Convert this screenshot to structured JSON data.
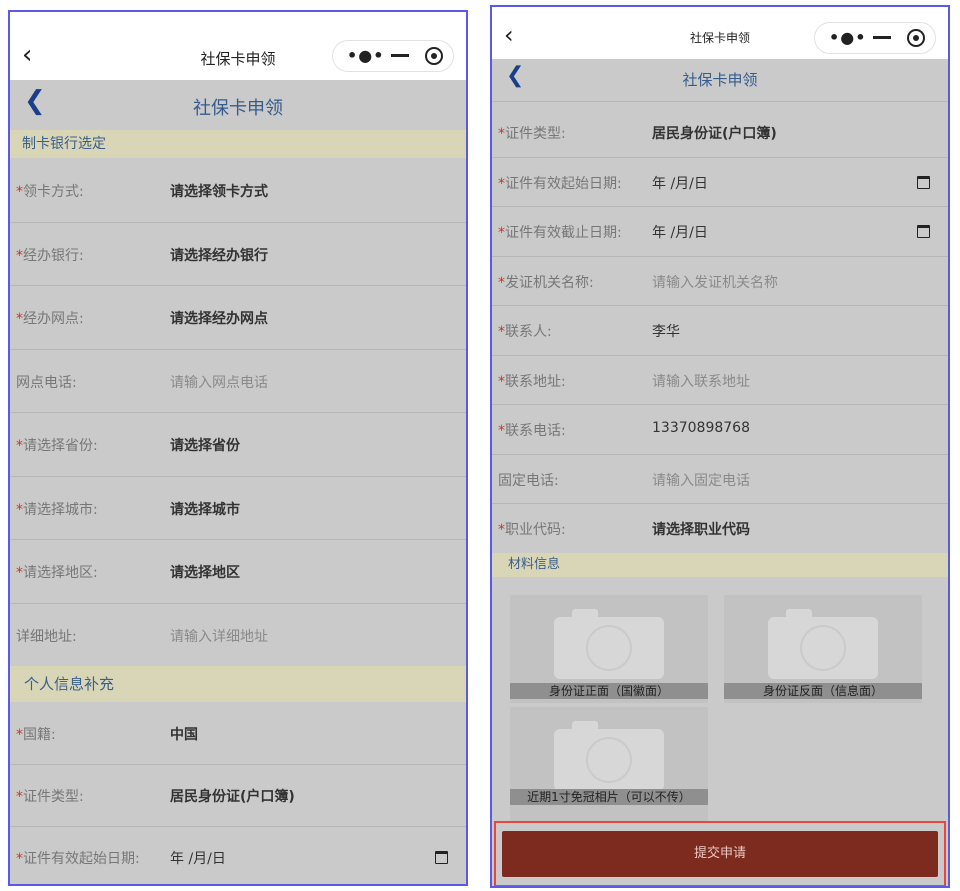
{
  "left": {
    "topbar": {
      "back_icon": "chevron-left-icon",
      "title": "社保卡申领",
      "dots": "•●•"
    },
    "navbar": {
      "back_icon": "chevron-left-icon",
      "title": "社保卡申领"
    },
    "section1": "制卡银行选定",
    "rows1": [
      {
        "req": "*",
        "label": "领卡方式:",
        "value": "请选择领卡方式",
        "kind": "select"
      },
      {
        "req": "*",
        "label": "经办银行:",
        "value": "请选择经办银行",
        "kind": "select"
      },
      {
        "req": "*",
        "label": "经办网点:",
        "value": "请选择经办网点",
        "kind": "select"
      },
      {
        "req": "",
        "label": "网点电话:",
        "value": "请输入网点电话",
        "kind": "input"
      },
      {
        "req": "*",
        "label": "请选择省份:",
        "value": "请选择省份",
        "kind": "select"
      },
      {
        "req": "*",
        "label": "请选择城市:",
        "value": "请选择城市",
        "kind": "select"
      },
      {
        "req": "*",
        "label": "请选择地区:",
        "value": "请选择地区",
        "kind": "select"
      },
      {
        "req": "",
        "label": "详细地址:",
        "value": "请输入详细地址",
        "kind": "input"
      }
    ],
    "section2": "个人信息补充",
    "rows2": [
      {
        "req": "*",
        "label": "国籍:",
        "value": "中国",
        "kind": "select"
      },
      {
        "req": "*",
        "label": "证件类型:",
        "value": "居民身份证(户口簿)",
        "kind": "select"
      },
      {
        "req": "*",
        "label": "证件有效起始日期:",
        "value": "年 /月/日",
        "kind": "date"
      }
    ]
  },
  "right": {
    "topbar": {
      "back_icon": "chevron-left-icon",
      "title": "社保卡申领",
      "dots": "•●•"
    },
    "navbar": {
      "back_icon": "chevron-left-icon",
      "title": "社保卡申领"
    },
    "rows": [
      {
        "req": "*",
        "label": "证件类型:",
        "value": "居民身份证(户口簿)",
        "kind": "select"
      },
      {
        "req": "*",
        "label": "证件有效起始日期:",
        "value": "年 /月/日",
        "kind": "date"
      },
      {
        "req": "*",
        "label": "证件有效截止日期:",
        "value": "年 /月/日",
        "kind": "date"
      },
      {
        "req": "*",
        "label": "发证机关名称:",
        "value": "请输入发证机关名称",
        "kind": "input"
      },
      {
        "req": "*",
        "label": "联系人:",
        "value": "李华",
        "kind": "filled"
      },
      {
        "req": "*",
        "label": "联系地址:",
        "value": "请输入联系地址",
        "kind": "input"
      },
      {
        "req": "*",
        "label": "联系电话:",
        "value": "13370898768",
        "kind": "filled"
      },
      {
        "req": "",
        "label": "固定电话:",
        "value": "请输入固定电话",
        "kind": "input"
      },
      {
        "req": "*",
        "label": "职业代码:",
        "value": "请选择职业代码",
        "kind": "select"
      }
    ],
    "section": "材料信息",
    "photos": [
      {
        "caption": "身份证正面（国徽面）",
        "icon": "camera-icon"
      },
      {
        "caption": "身份证反面（信息面）",
        "icon": "camera-icon"
      },
      {
        "caption": "近期1寸免冠相片（可以不传）",
        "icon": "camera-icon"
      }
    ],
    "submit": "提交申请"
  }
}
